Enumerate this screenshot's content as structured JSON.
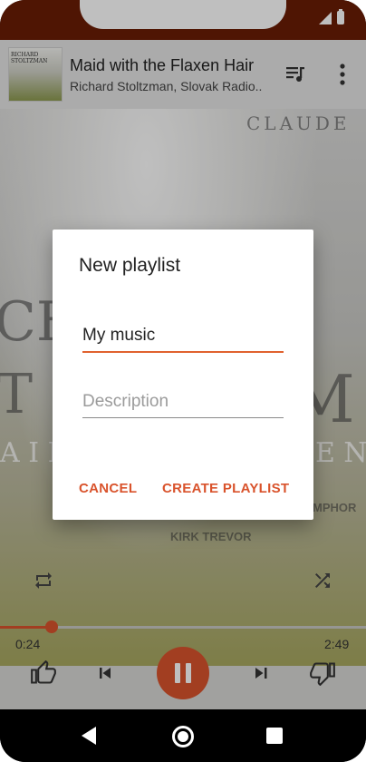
{
  "now_playing": {
    "title": "Maid with the Flaxen Hair",
    "artist": "Richard Stoltzman, Slovak Radio..",
    "thumbnail_text": "RICHARD STOLTZMAN"
  },
  "album_art": {
    "line_claude": "CLAUDE",
    "line_ch": "CH",
    "line_tl": "T L",
    "line_m": "M",
    "line_aid": "A I D",
    "line_en": "E N",
    "line_mphor": "MPHOR",
    "line_kirk": "KIRK TREVOR"
  },
  "player": {
    "elapsed": "0:24",
    "duration": "2:49",
    "progress_fraction": 0.142
  },
  "dialog": {
    "title": "New playlist",
    "name_value": "My music",
    "description_placeholder": "Description",
    "cancel_label": "CANCEL",
    "create_label": "CREATE PLAYLIST"
  },
  "colors": {
    "accent": "#d9532c",
    "status_bar": "#6a1d05"
  },
  "icons": {
    "queue": "queue-music-icon",
    "more": "more-vert-icon",
    "repeat": "repeat-icon",
    "shuffle": "shuffle-icon",
    "thumb_up": "thumb-up-icon",
    "previous": "skip-previous-icon",
    "pause": "pause-icon",
    "next": "skip-next-icon",
    "thumb_down": "thumb-down-icon"
  }
}
